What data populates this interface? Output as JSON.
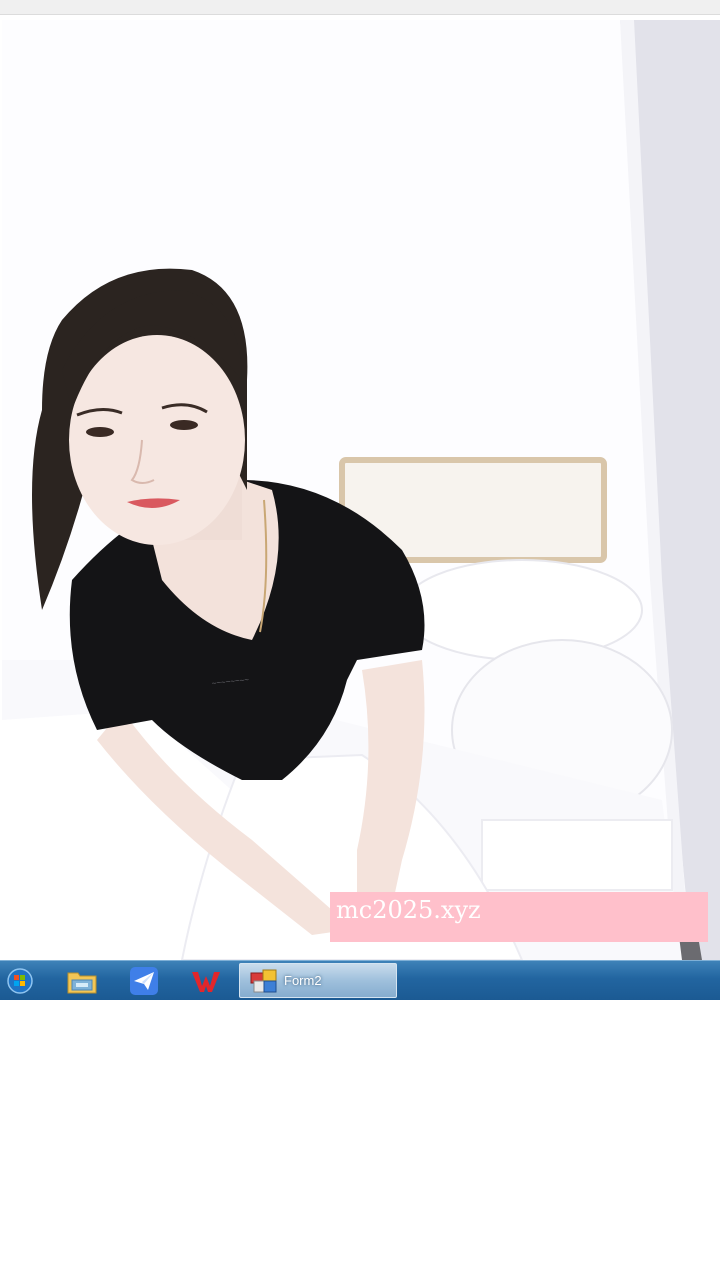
{
  "photo": {
    "watermark_text": "mc2025.xyz"
  },
  "taskbar": {
    "start_icon": "windows-start-icon",
    "pinned": [
      {
        "name": "file-explorer-icon"
      },
      {
        "name": "paper-plane-app-icon"
      },
      {
        "name": "wps-office-icon"
      }
    ],
    "active_window": {
      "label": "Form2",
      "icon": "windows-form-app-icon"
    }
  },
  "colors": {
    "taskbar": "#1b5a93",
    "watermark_bg": "#ffc0cb",
    "watermark_text": "#ffffff"
  }
}
